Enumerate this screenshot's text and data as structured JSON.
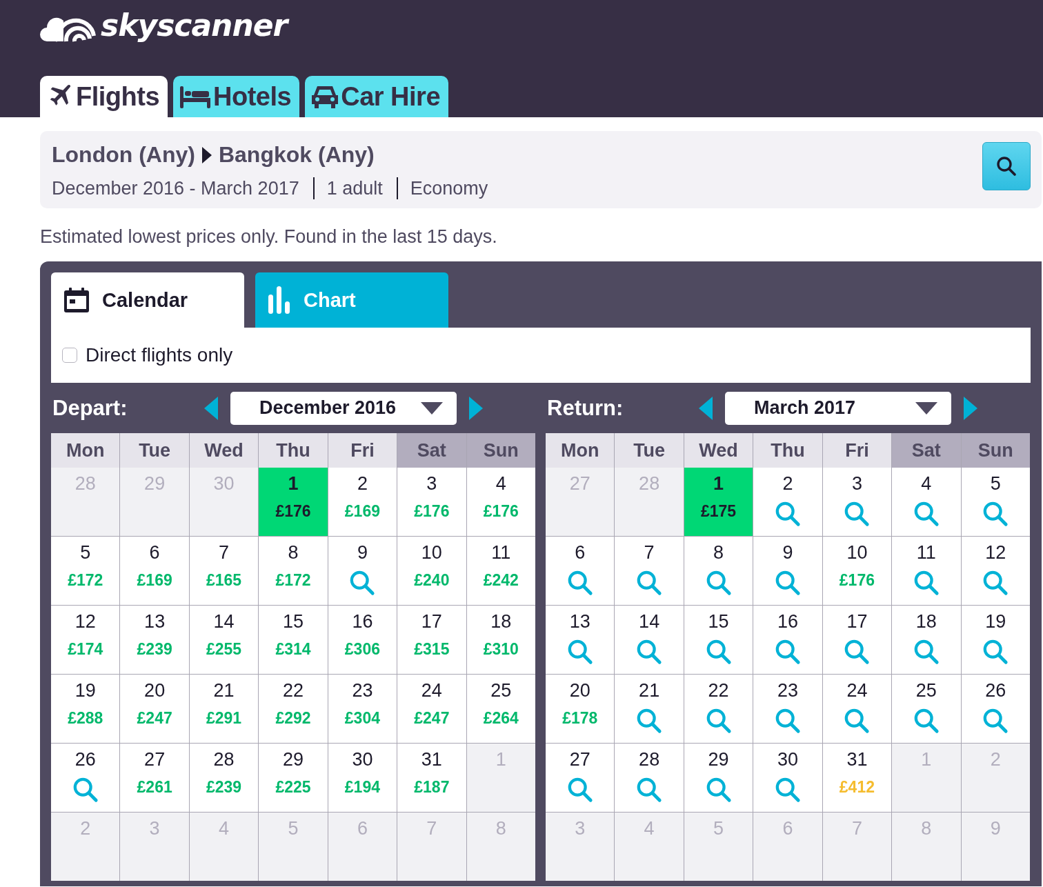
{
  "brand": {
    "name": "skyscanner"
  },
  "nav_tabs": [
    {
      "label": "Flights",
      "selected": true
    },
    {
      "label": "Hotels",
      "selected": false
    },
    {
      "label": "Car Hire",
      "selected": false
    }
  ],
  "search_summary": {
    "origin": "London (Any)",
    "destination": "Bangkok (Any)",
    "details": [
      "December 2016 - March 2017",
      "1 adult",
      "Economy"
    ]
  },
  "notice": "Estimated lowest prices only. Found in the last 15 days.",
  "view_tabs": [
    {
      "label": "Calendar",
      "selected": true
    },
    {
      "label": "Chart",
      "selected": false
    }
  ],
  "direct_only": {
    "label": "Direct flights only",
    "checked": false
  },
  "calendars": [
    {
      "label": "Depart:",
      "month": "December 2016",
      "weekdays": [
        {
          "label": "Mon",
          "weekend": false
        },
        {
          "label": "Tue",
          "weekend": false
        },
        {
          "label": "Wed",
          "weekend": false
        },
        {
          "label": "Thu",
          "weekend": false
        },
        {
          "label": "Fri",
          "weekend": false
        },
        {
          "label": "Sat",
          "weekend": true
        },
        {
          "label": "Sun",
          "weekend": true
        }
      ],
      "weeks": [
        [
          {
            "day": "28",
            "kind": "outside",
            "selected": false
          },
          {
            "day": "29",
            "kind": "outside",
            "selected": false
          },
          {
            "day": "30",
            "kind": "outside",
            "selected": false
          },
          {
            "day": "1",
            "kind": "price",
            "price": "£176",
            "selected": true
          },
          {
            "day": "2",
            "kind": "price",
            "price": "£169",
            "color": "#00b86b",
            "selected": false
          },
          {
            "day": "3",
            "kind": "price",
            "price": "£176",
            "color": "#00b86b",
            "selected": false
          },
          {
            "day": "4",
            "kind": "price",
            "price": "£176",
            "color": "#00b86b",
            "selected": false
          }
        ],
        [
          {
            "day": "5",
            "kind": "price",
            "price": "£172",
            "color": "#00b86b",
            "selected": false
          },
          {
            "day": "6",
            "kind": "price",
            "price": "£169",
            "color": "#00b86b",
            "selected": false
          },
          {
            "day": "7",
            "kind": "price",
            "price": "£165",
            "color": "#00b86b",
            "selected": false
          },
          {
            "day": "8",
            "kind": "price",
            "price": "£172",
            "color": "#00b86b",
            "selected": false
          },
          {
            "day": "9",
            "kind": "search",
            "selected": false
          },
          {
            "day": "10",
            "kind": "price",
            "price": "£240",
            "color": "#00b86b",
            "selected": false
          },
          {
            "day": "11",
            "kind": "price",
            "price": "£242",
            "color": "#00b86b",
            "selected": false
          }
        ],
        [
          {
            "day": "12",
            "kind": "price",
            "price": "£174",
            "color": "#00b86b",
            "selected": false
          },
          {
            "day": "13",
            "kind": "price",
            "price": "£239",
            "color": "#00b86b",
            "selected": false
          },
          {
            "day": "14",
            "kind": "price",
            "price": "£255",
            "color": "#00b86b",
            "selected": false
          },
          {
            "day": "15",
            "kind": "price",
            "price": "£314",
            "color": "#00b86b",
            "selected": false
          },
          {
            "day": "16",
            "kind": "price",
            "price": "£306",
            "color": "#00b86b",
            "selected": false
          },
          {
            "day": "17",
            "kind": "price",
            "price": "£315",
            "color": "#00b86b",
            "selected": false
          },
          {
            "day": "18",
            "kind": "price",
            "price": "£310",
            "color": "#00b86b",
            "selected": false
          }
        ],
        [
          {
            "day": "19",
            "kind": "price",
            "price": "£288",
            "color": "#00b86b",
            "selected": false
          },
          {
            "day": "20",
            "kind": "price",
            "price": "£247",
            "color": "#00b86b",
            "selected": false
          },
          {
            "day": "21",
            "kind": "price",
            "price": "£291",
            "color": "#00b86b",
            "selected": false
          },
          {
            "day": "22",
            "kind": "price",
            "price": "£292",
            "color": "#00b86b",
            "selected": false
          },
          {
            "day": "23",
            "kind": "price",
            "price": "£304",
            "color": "#00b86b",
            "selected": false
          },
          {
            "day": "24",
            "kind": "price",
            "price": "£247",
            "color": "#00b86b",
            "selected": false
          },
          {
            "day": "25",
            "kind": "price",
            "price": "£264",
            "color": "#00b86b",
            "selected": false
          }
        ],
        [
          {
            "day": "26",
            "kind": "search",
            "selected": false
          },
          {
            "day": "27",
            "kind": "price",
            "price": "£261",
            "color": "#00b86b",
            "selected": false
          },
          {
            "day": "28",
            "kind": "price",
            "price": "£239",
            "color": "#00b86b",
            "selected": false
          },
          {
            "day": "29",
            "kind": "price",
            "price": "£225",
            "color": "#00b86b",
            "selected": false
          },
          {
            "day": "30",
            "kind": "price",
            "price": "£194",
            "color": "#00b86b",
            "selected": false
          },
          {
            "day": "31",
            "kind": "price",
            "price": "£187",
            "color": "#00b86b",
            "selected": false
          },
          {
            "day": "1",
            "kind": "outside",
            "selected": false
          }
        ],
        [
          {
            "day": "2",
            "kind": "outside",
            "selected": false
          },
          {
            "day": "3",
            "kind": "outside",
            "selected": false
          },
          {
            "day": "4",
            "kind": "outside",
            "selected": false
          },
          {
            "day": "5",
            "kind": "outside",
            "selected": false
          },
          {
            "day": "6",
            "kind": "outside",
            "selected": false
          },
          {
            "day": "7",
            "kind": "outside",
            "selected": false
          },
          {
            "day": "8",
            "kind": "outside",
            "selected": false
          }
        ]
      ]
    },
    {
      "label": "Return:",
      "month": "March 2017",
      "weekdays": [
        {
          "label": "Mon",
          "weekend": false
        },
        {
          "label": "Tue",
          "weekend": false
        },
        {
          "label": "Wed",
          "weekend": false
        },
        {
          "label": "Thu",
          "weekend": false
        },
        {
          "label": "Fri",
          "weekend": false
        },
        {
          "label": "Sat",
          "weekend": true
        },
        {
          "label": "Sun",
          "weekend": true
        }
      ],
      "weeks": [
        [
          {
            "day": "27",
            "kind": "outside",
            "selected": false
          },
          {
            "day": "28",
            "kind": "outside",
            "selected": false
          },
          {
            "day": "1",
            "kind": "price",
            "price": "£175",
            "selected": true
          },
          {
            "day": "2",
            "kind": "search",
            "selected": false
          },
          {
            "day": "3",
            "kind": "search",
            "selected": false
          },
          {
            "day": "4",
            "kind": "search",
            "selected": false
          },
          {
            "day": "5",
            "kind": "search",
            "selected": false
          }
        ],
        [
          {
            "day": "6",
            "kind": "search",
            "selected": false
          },
          {
            "day": "7",
            "kind": "search",
            "selected": false
          },
          {
            "day": "8",
            "kind": "search",
            "selected": false
          },
          {
            "day": "9",
            "kind": "search",
            "selected": false
          },
          {
            "day": "10",
            "kind": "price",
            "price": "£176",
            "color": "#00b86b",
            "selected": false
          },
          {
            "day": "11",
            "kind": "search",
            "selected": false
          },
          {
            "day": "12",
            "kind": "search",
            "selected": false
          }
        ],
        [
          {
            "day": "13",
            "kind": "search",
            "selected": false
          },
          {
            "day": "14",
            "kind": "search",
            "selected": false
          },
          {
            "day": "15",
            "kind": "search",
            "selected": false
          },
          {
            "day": "16",
            "kind": "search",
            "selected": false
          },
          {
            "day": "17",
            "kind": "search",
            "selected": false
          },
          {
            "day": "18",
            "kind": "search",
            "selected": false
          },
          {
            "day": "19",
            "kind": "search",
            "selected": false
          }
        ],
        [
          {
            "day": "20",
            "kind": "price",
            "price": "£178",
            "color": "#00b86b",
            "selected": false
          },
          {
            "day": "21",
            "kind": "search",
            "selected": false
          },
          {
            "day": "22",
            "kind": "search",
            "selected": false
          },
          {
            "day": "23",
            "kind": "search",
            "selected": false
          },
          {
            "day": "24",
            "kind": "search",
            "selected": false
          },
          {
            "day": "25",
            "kind": "search",
            "selected": false
          },
          {
            "day": "26",
            "kind": "search",
            "selected": false
          }
        ],
        [
          {
            "day": "27",
            "kind": "search",
            "selected": false
          },
          {
            "day": "28",
            "kind": "search",
            "selected": false
          },
          {
            "day": "29",
            "kind": "search",
            "selected": false
          },
          {
            "day": "30",
            "kind": "search",
            "selected": false
          },
          {
            "day": "31",
            "kind": "price",
            "price": "£412",
            "color": "#f5bc2e",
            "selected": false
          },
          {
            "day": "1",
            "kind": "outside",
            "selected": false
          },
          {
            "day": "2",
            "kind": "outside",
            "selected": false
          }
        ],
        [
          {
            "day": "3",
            "kind": "outside",
            "selected": false
          },
          {
            "day": "4",
            "kind": "outside",
            "selected": false
          },
          {
            "day": "5",
            "kind": "outside",
            "selected": false
          },
          {
            "day": "6",
            "kind": "outside",
            "selected": false
          },
          {
            "day": "7",
            "kind": "outside",
            "selected": false
          },
          {
            "day": "8",
            "kind": "outside",
            "selected": false
          },
          {
            "day": "9",
            "kind": "outside",
            "selected": false
          }
        ]
      ]
    }
  ]
}
